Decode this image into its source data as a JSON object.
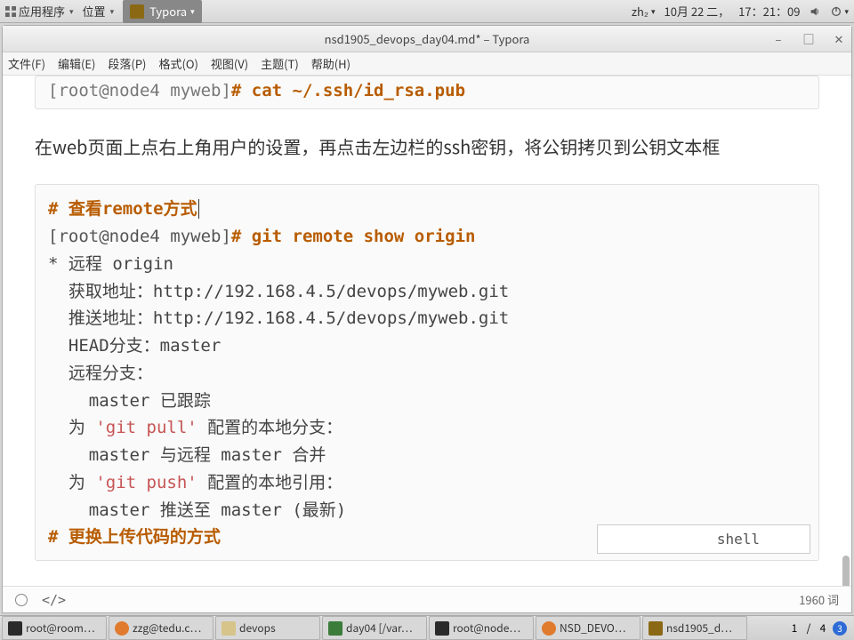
{
  "gnome": {
    "applications": "应用程序",
    "places": "位置",
    "active_app": "Typora",
    "input_method": "zh₂",
    "date": "10月 22 二，",
    "time": "17：21：09"
  },
  "window": {
    "title": "nsd1905_devops_day04.md* – Typora"
  },
  "menubar": {
    "file": "文件(F)",
    "edit": "编辑(E)",
    "paragraph": "段落(P)",
    "format": "格式(O)",
    "view": "视图(V)",
    "theme": "主题(T)",
    "help": "帮助(H)"
  },
  "content": {
    "top_prompt": "[root@node4 myweb]",
    "top_cmd": "# cat ~/.ssh/id_rsa.pub",
    "paragraph": "在web页面上点右上角用户的设置，再点击左边栏的ssh密钥，将公钥拷贝到公钥文本框",
    "comment1": "# 查看remote方式",
    "prompt2": "[root@node4 myweb]",
    "cmd2": "# git remote show origin",
    "line3": "* 远程 origin",
    "line4": "  获取地址：http://192.168.4.5/devops/myweb.git",
    "line5": "  推送地址：http://192.168.4.5/devops/myweb.git",
    "line6": "  HEAD分支：master",
    "line7": "  远程分支：",
    "line8": "    master 已跟踪",
    "line9a": "  为 ",
    "line9q": "'git pull'",
    "line9b": " 配置的本地分支：",
    "line10": "    master 与远程 master 合并",
    "line11a": "  为 ",
    "line11q": "'git push'",
    "line11b": " 配置的本地引用：",
    "line12": "    master 推送至 master (最新)",
    "comment2": "# 更换上传代码的方式",
    "shell_lang": "shell"
  },
  "statusbar": {
    "words": "1960 词"
  },
  "taskbar": {
    "t1": "root@room…",
    "t2": "zzg@tedu.c…",
    "t3": "devops",
    "t4": "day04 [/var…",
    "t5": "root@node…",
    "t6": "NSD_DEVO…",
    "t7": "nsd1905_d…",
    "ws_current": "1",
    "ws_sep": "/",
    "ws_total": "4",
    "badge": "3"
  }
}
